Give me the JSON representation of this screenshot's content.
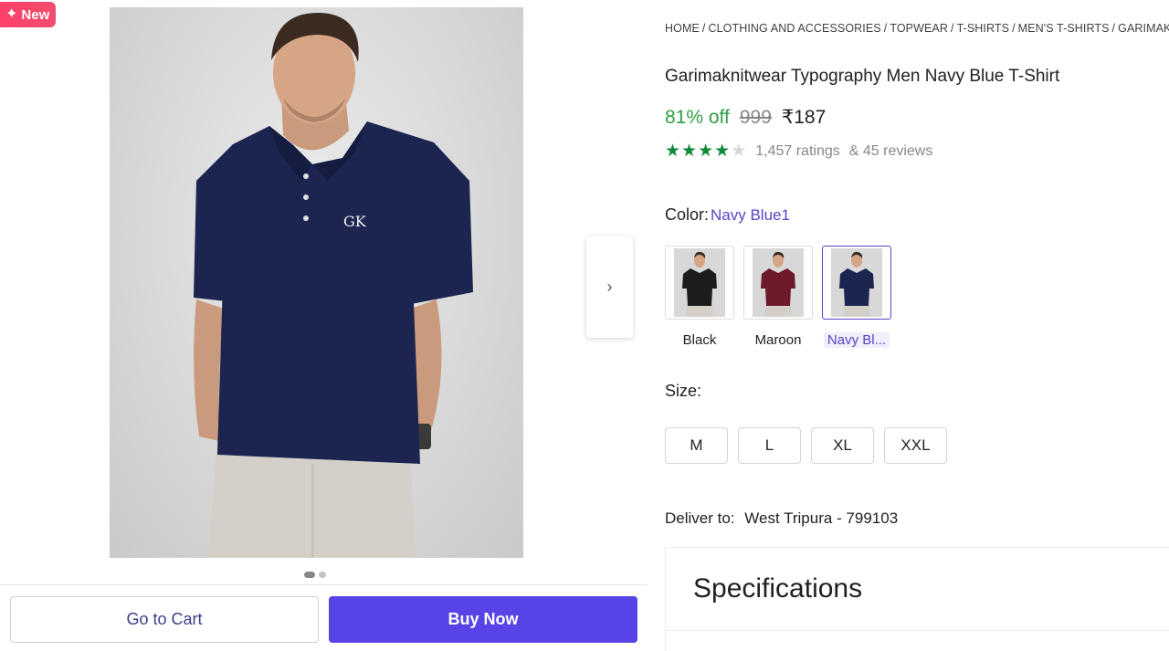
{
  "badge": {
    "label": "New",
    "icon": "sparkle-icon"
  },
  "gallery": {
    "next_icon": "chevron-right-icon",
    "next_glyph": "›",
    "dot_count": 2,
    "active_dot": 0
  },
  "actions": {
    "cart_label": "Go to Cart",
    "buy_label": "Buy Now"
  },
  "breadcrumb": [
    "HOME",
    "CLOTHING AND ACCESSORIES",
    "TOPWEAR",
    "T-SHIRTS",
    "MEN'S T-SHIRTS",
    "GARIMAKNITWEAR T-SHIRTS"
  ],
  "product": {
    "title": "Garimaknitwear Typography Men Navy Blue T-Shirt",
    "discount": "81% off",
    "mrp": "999",
    "price": "₹187",
    "rating_stars": 4,
    "ratings_text": "1,457 ratings",
    "reviews_text": "& 45 reviews"
  },
  "color": {
    "label": "Color:",
    "selected": "Navy Blue1",
    "options": [
      {
        "name": "Black",
        "shirt": "#1c1c1c"
      },
      {
        "name": "Maroon",
        "shirt": "#6e1a2a"
      },
      {
        "name": "Navy Bl...",
        "shirt": "#1b2550"
      }
    ]
  },
  "size": {
    "label": "Size:",
    "options": [
      "M",
      "L",
      "XL",
      "XXL"
    ]
  },
  "delivery": {
    "label": "Deliver to:",
    "location": "West Tripura - 799103"
  },
  "specifications": {
    "title": "Specifications"
  },
  "colors": {
    "accent": "#5644e6",
    "discount_green": "#2e9e45",
    "star_green": "#0f8a3b",
    "badge_pink": "#ff3f6c",
    "shirt_navy": "#1b2550"
  }
}
